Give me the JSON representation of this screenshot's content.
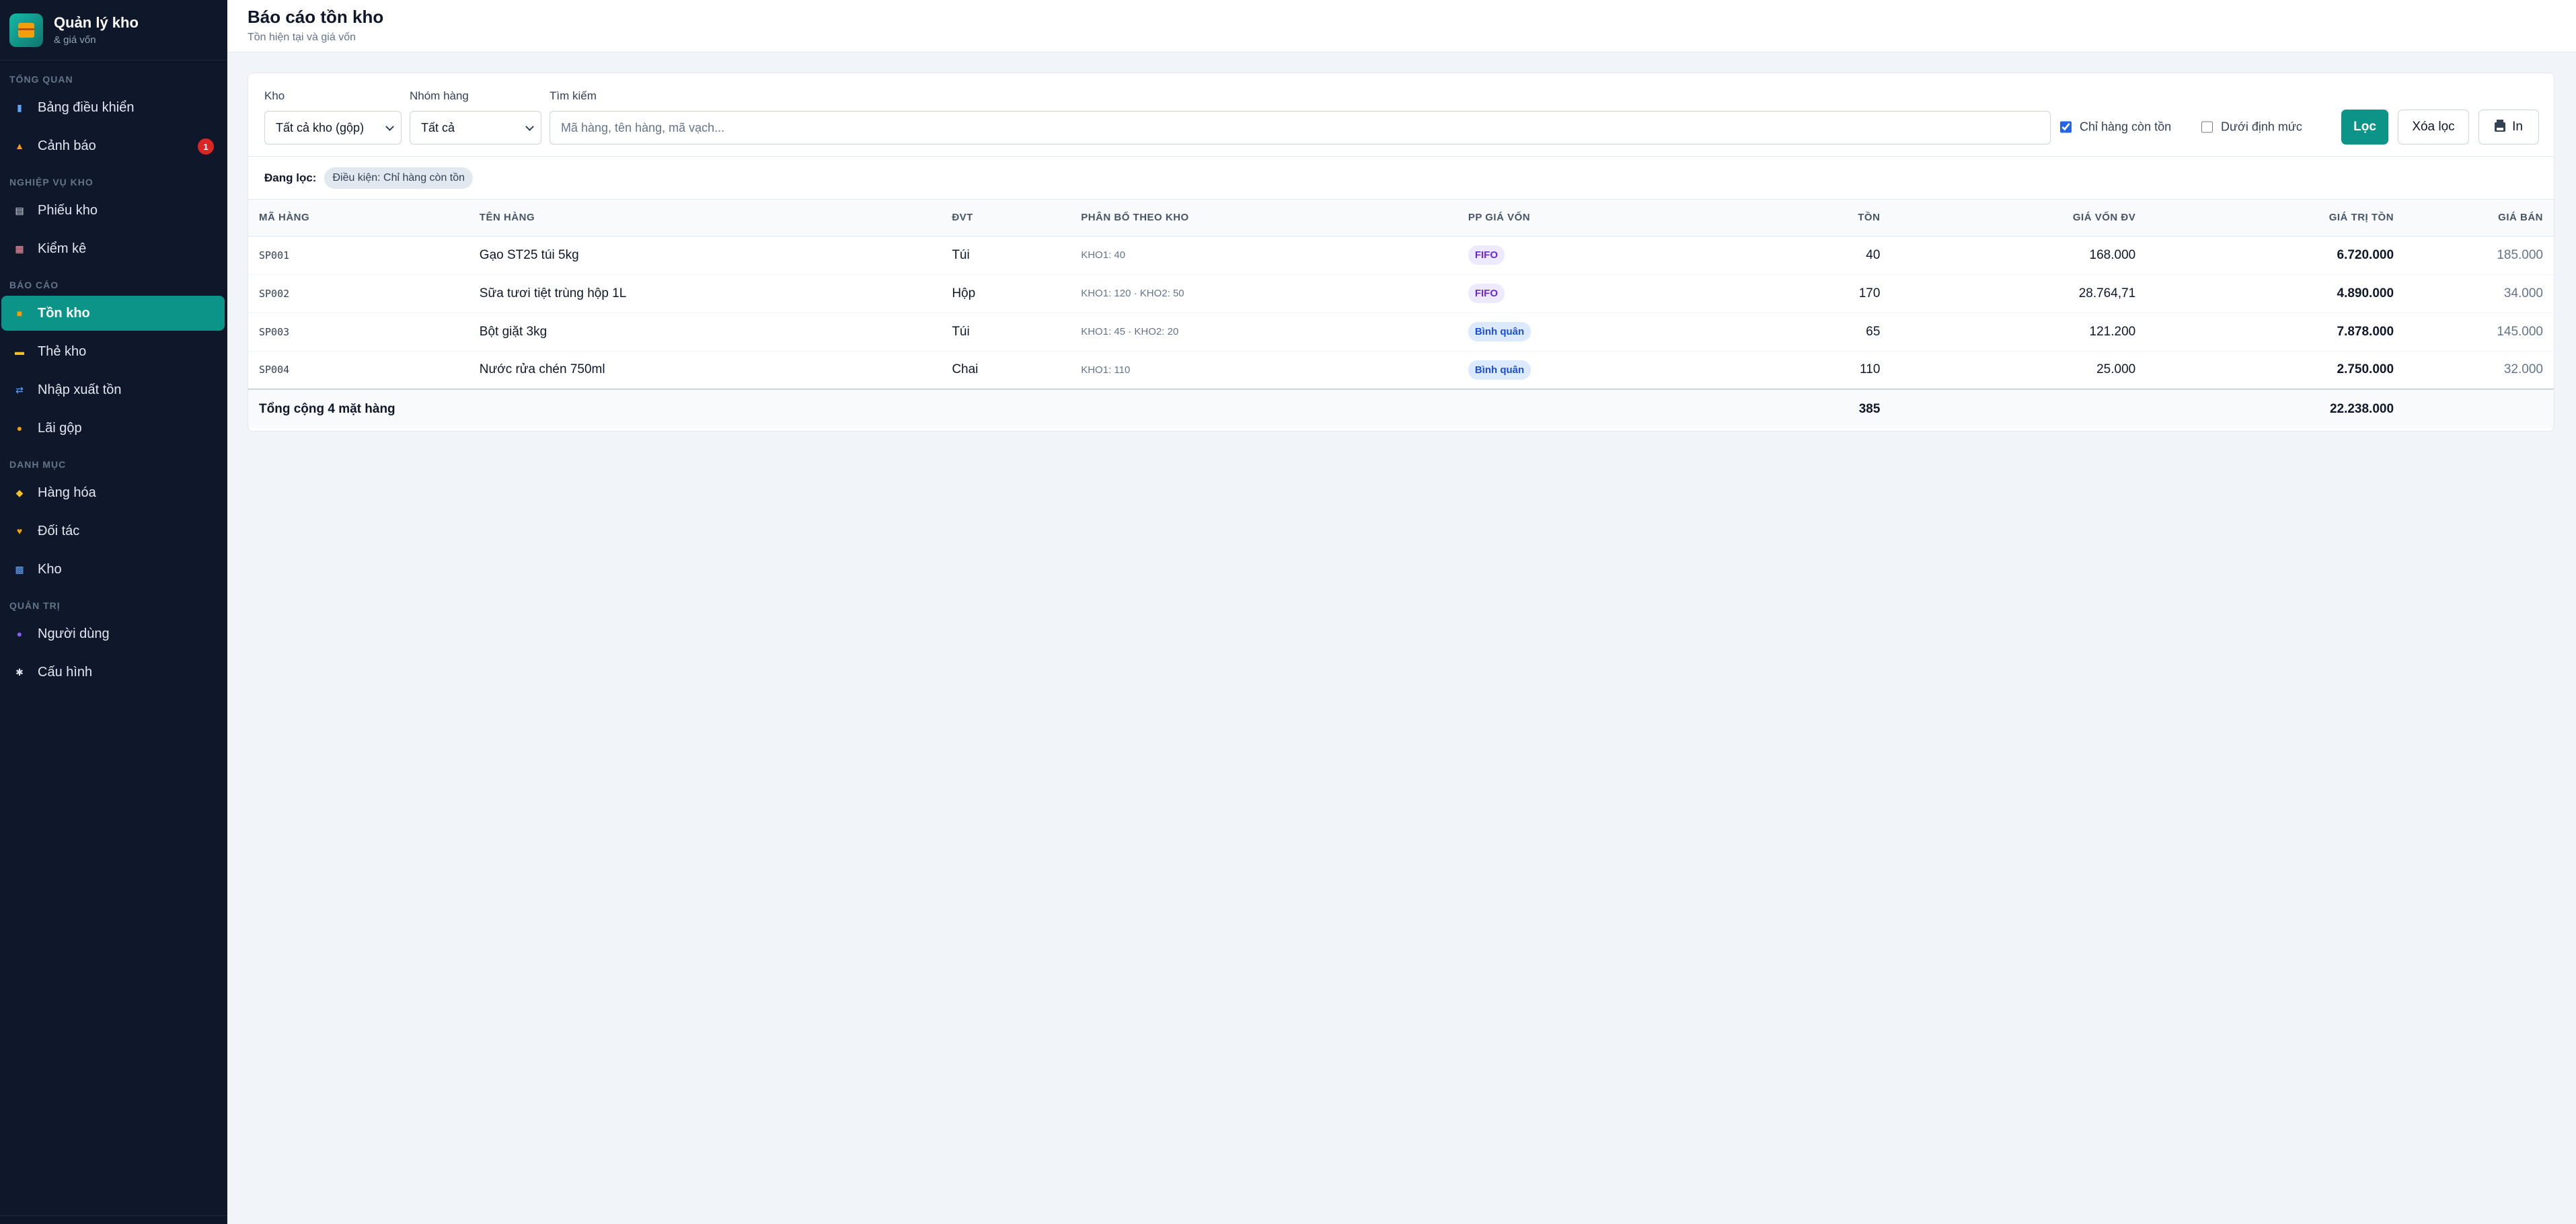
{
  "app": {
    "title": "Quản lý kho",
    "subtitle": "& giá vốn"
  },
  "sidebar": {
    "sections": [
      {
        "title": "TỔNG QUAN",
        "items": [
          {
            "label": "Bảng điều khiển",
            "icon": "chart-icon",
            "color": "#60a5fa"
          },
          {
            "label": "Cảnh báo",
            "icon": "bell-icon",
            "color": "#f59e0b",
            "badge": "1"
          }
        ]
      },
      {
        "title": "NGHIỆP VỤ KHO",
        "items": [
          {
            "label": "Phiếu kho",
            "icon": "receipt-icon",
            "color": "#e2e8f0"
          },
          {
            "label": "Kiểm kê",
            "icon": "clipboard-icon",
            "color": "#fca5a5"
          }
        ]
      },
      {
        "title": "BÁO CÁO",
        "items": [
          {
            "label": "Tồn kho",
            "icon": "box-icon",
            "color": "#f59e0b",
            "active": true
          },
          {
            "label": "Thẻ kho",
            "icon": "card-icon",
            "color": "#fbbf24"
          },
          {
            "label": "Nhập xuất tồn",
            "icon": "swap-icon",
            "color": "#60a5fa"
          },
          {
            "label": "Lãi gộp",
            "icon": "money-bag-icon",
            "color": "#f59e0b"
          }
        ]
      },
      {
        "title": "DANH MỤC",
        "items": [
          {
            "label": "Hàng hóa",
            "icon": "tag-icon",
            "color": "#fbbf24"
          },
          {
            "label": "Đối tác",
            "icon": "handshake-icon",
            "color": "#f59e0b"
          },
          {
            "label": "Kho",
            "icon": "warehouse-icon",
            "color": "#60a5fa"
          }
        ]
      },
      {
        "title": "QUẢN TRỊ",
        "items": [
          {
            "label": "Người dùng",
            "icon": "users-icon",
            "color": "#8b5cf6"
          },
          {
            "label": "Cấu hình",
            "icon": "gear-icon",
            "color": "#e2e8f0"
          }
        ]
      }
    ]
  },
  "header": {
    "title": "Báo cáo tồn kho",
    "subtitle": "Tồn hiện tại và giá vốn"
  },
  "filters": {
    "warehouse_label": "Kho",
    "warehouse_value": "Tất cả kho (gộp)",
    "group_label": "Nhóm hàng",
    "group_value": "Tất cả",
    "search_label": "Tìm kiếm",
    "search_placeholder": "Mã hàng, tên hàng, mã vạch...",
    "in_stock_label": "Chỉ hàng còn tồn",
    "in_stock_checked": true,
    "below_min_label": "Dưới định mức",
    "below_min_checked": false,
    "apply_label": "Lọc",
    "clear_label": "Xóa lọc",
    "print_label": "In"
  },
  "active_filters": {
    "label": "Đang lọc:",
    "chip": "Điều kiện: Chỉ hàng còn tồn"
  },
  "table": {
    "columns": [
      "MÃ HÀNG",
      "TÊN HÀNG",
      "ĐVT",
      "PHÂN BỔ THEO KHO",
      "PP GIÁ VỐN",
      "TỒN",
      "GIÁ VỐN ĐV",
      "GIÁ TRỊ TỒN",
      "GIÁ BÁN"
    ],
    "rows": [
      {
        "code": "SP001",
        "name": "Gạo ST25 túi 5kg",
        "unit": "Túi",
        "distribution": "KHO1: 40",
        "method": "FIFO",
        "qty": "40",
        "unit_cost": "168.000",
        "value": "6.720.000",
        "price": "185.000"
      },
      {
        "code": "SP002",
        "name": "Sữa tươi tiệt trùng hộp 1L",
        "unit": "Hộp",
        "distribution": "KHO1: 120 · KHO2: 50",
        "method": "FIFO",
        "qty": "170",
        "unit_cost": "28.764,71",
        "value": "4.890.000",
        "price": "34.000"
      },
      {
        "code": "SP003",
        "name": "Bột giặt 3kg",
        "unit": "Túi",
        "distribution": "KHO1: 45 · KHO2: 20",
        "method": "Bình quân",
        "qty": "65",
        "unit_cost": "121.200",
        "value": "7.878.000",
        "price": "145.000"
      },
      {
        "code": "SP004",
        "name": "Nước rửa chén 750ml",
        "unit": "Chai",
        "distribution": "KHO1: 110",
        "method": "Bình quân",
        "qty": "110",
        "unit_cost": "25.000",
        "value": "2.750.000",
        "price": "32.000"
      }
    ],
    "total": {
      "label": "Tổng cộng 4 mặt hàng",
      "qty": "385",
      "value": "22.238.000"
    }
  }
}
